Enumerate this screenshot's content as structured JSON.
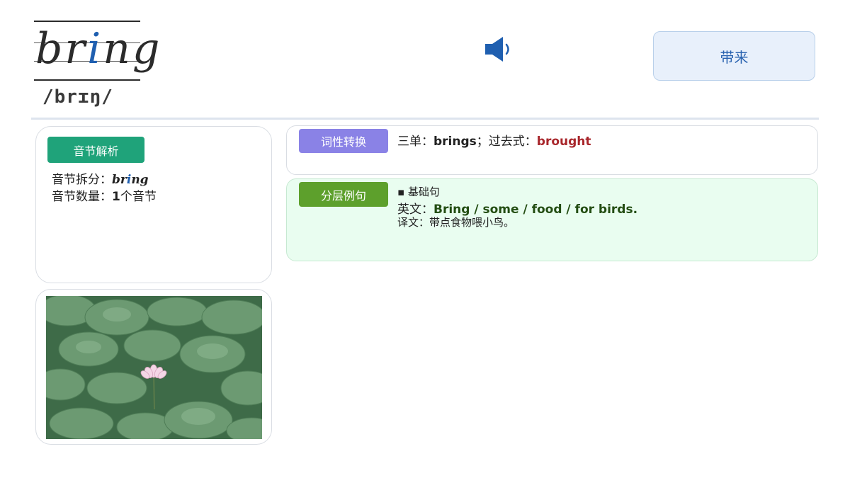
{
  "word": {
    "prefix": "br",
    "highlight": "i",
    "suffix": "ng",
    "phonetic": "/brɪŋ/"
  },
  "header": {
    "speaker_icon": "speaker-icon",
    "meaning": "带来"
  },
  "syllable": {
    "tag": "音节解析",
    "split_label": "音节拆分：",
    "split_prefix": "br",
    "split_highlight": "i",
    "split_suffix": "ng",
    "count_label": "音节数量：",
    "count_value": "1",
    "count_unit": "个音节"
  },
  "pos": {
    "tag": "词性转换",
    "third_label": "三单：",
    "third_value": "brings",
    "sep": "；",
    "past_label": "过去式：",
    "past_value": "brought"
  },
  "examples": {
    "tag": "分层例句",
    "level": "▪ 基础句",
    "en_label": "英文：",
    "en_value": "Bring / some / food / for birds.",
    "cn_label": "译文：",
    "cn_value": "带点食物喂小鸟。"
  },
  "image": {
    "description_icon": "lotus-pond-photo"
  },
  "colors": {
    "word_highlight": "#1f5fb0",
    "tag_syllable": "#1fa37a",
    "tag_pos": "#8a82e6",
    "tag_examples": "#5da02c",
    "past_tense": "#a8262b",
    "examples_bg": "#e9fdf0"
  }
}
